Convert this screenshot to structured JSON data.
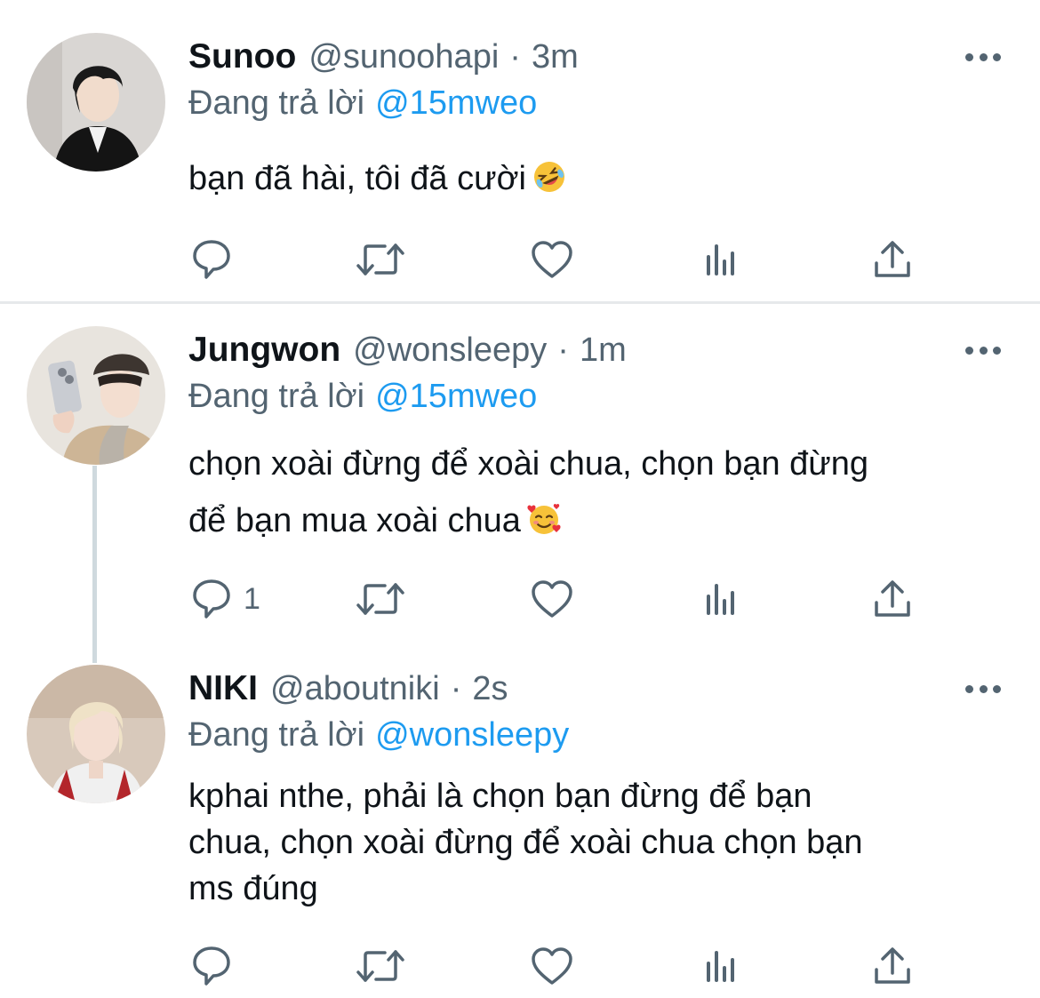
{
  "tweets": [
    {
      "name": "Sunoo",
      "handle": "@sunoohapi",
      "separator": "·",
      "time": "3m",
      "replying_prefix": "Đang trả lời",
      "replying_to": "@15mweo",
      "lines": [
        "bạn đã hài, tôi đã cười"
      ],
      "emoji": "rolling-on-floor-laughing-emoji",
      "reply_count": ""
    },
    {
      "name": "Jungwon",
      "handle": "@wonsleepy",
      "separator": "·",
      "time": "1m",
      "replying_prefix": "Đang trả lời",
      "replying_to": "@15mweo",
      "lines": [
        "chọn xoài đừng để xoài chua, chọn bạn đừng",
        "để bạn mua xoài chua"
      ],
      "emoji": "smiling-face-with-hearts-emoji",
      "reply_count": "1"
    },
    {
      "name": "NIKI",
      "handle": "@aboutniki",
      "separator": "·",
      "time": "2s",
      "replying_prefix": "Đang trả lời",
      "replying_to": "@wonsleepy",
      "lines": [
        "kphai nthe, phải là chọn bạn đừng để bạn",
        "chua, chọn xoài đừng để xoài chua chọn bạn",
        "ms đúng"
      ],
      "emoji": "",
      "reply_count": ""
    }
  ],
  "icons": [
    "reply-icon",
    "retweet-icon",
    "like-icon",
    "analytics-icon",
    "share-icon",
    "more-icon"
  ],
  "colors": {
    "text": "#0f1419",
    "secondary": "#536471",
    "link": "#1d9bf0",
    "divider": "#e6e9eb",
    "thread_line": "#cfd9de"
  }
}
